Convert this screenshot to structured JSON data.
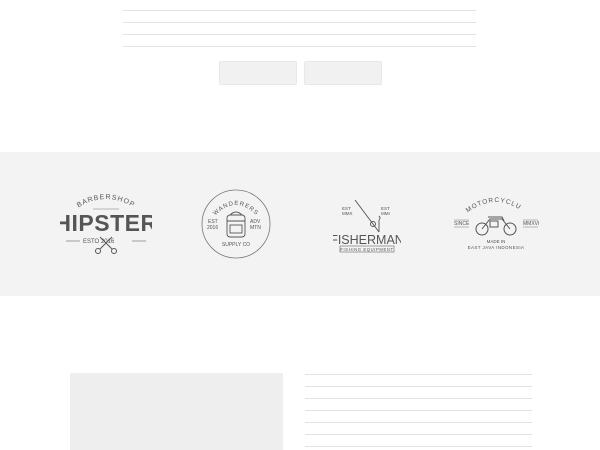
{
  "logos": {
    "hipster": {
      "top_arc": "BARBERSHOP",
      "main": "HIPSTER",
      "bottom": "ESTO 2016"
    },
    "wanderers": {
      "top_arc": "WANDERERS",
      "left_col": [
        "EST",
        "2016"
      ],
      "right_col": [
        "ADV",
        "MTN"
      ],
      "bottom": "SUPPLY CO"
    },
    "fisherman": {
      "left_tag": [
        "EST",
        "MMX"
      ],
      "right_tag": [
        "EST",
        "MMI"
      ],
      "main": "FISHERMAN",
      "sub": "FISHING EQUIPMENT"
    },
    "motorcycle": {
      "top_arc": "MOTORCYCLUB",
      "left_tag": "SINCE",
      "right_tag": "MMXVI",
      "line1": "MADE IN",
      "line2": "EAST JAVA INDONESIA"
    }
  }
}
